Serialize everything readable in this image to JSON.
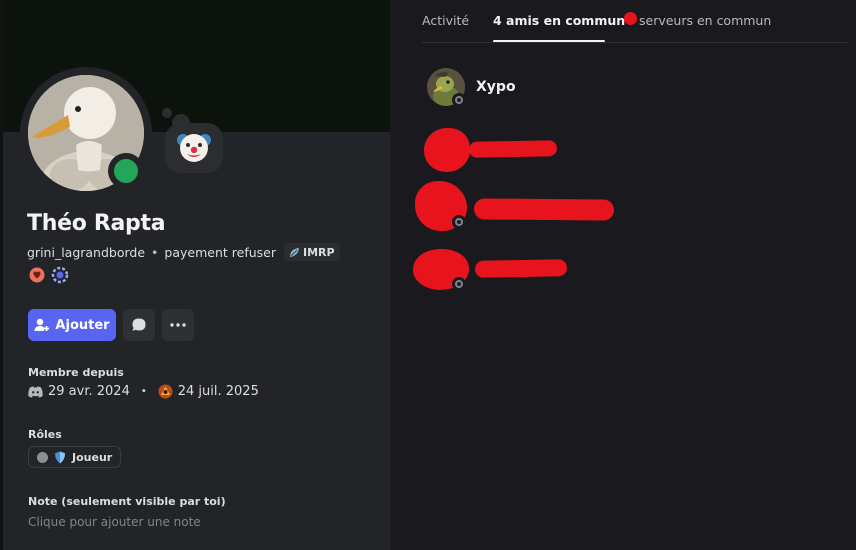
{
  "profile": {
    "display_name": "Théo Rapta",
    "username": "grini_lagrandborde",
    "separator": "•",
    "custom_status": "payement refuser",
    "server_tag": "IMRP",
    "add_button_label": "Ajouter",
    "status": "online",
    "status_color": "#23a55a",
    "thought_emoji": "clown-face",
    "badges": [
      "heart-badge",
      "gear-badge"
    ]
  },
  "member_since": {
    "heading": "Membre depuis",
    "discord_date": "29 avr. 2024",
    "dot": "•",
    "server_date": "24 juil. 2025"
  },
  "roles": {
    "heading": "Rôles",
    "items": [
      {
        "name": "Joueur"
      }
    ]
  },
  "note": {
    "heading": "Note (seulement visible par toi)",
    "placeholder": "Clique pour ajouter une note"
  },
  "tabs": [
    {
      "label": "Activité",
      "active": false
    },
    {
      "label": "4 amis en commun",
      "active": true
    },
    {
      "label": "serveurs en commun",
      "active": false
    }
  ],
  "mutual_friends": [
    {
      "name": "Xypo",
      "status": "offline"
    }
  ],
  "colors": {
    "accent": "#5865f2",
    "redaction": "#e8141d"
  }
}
